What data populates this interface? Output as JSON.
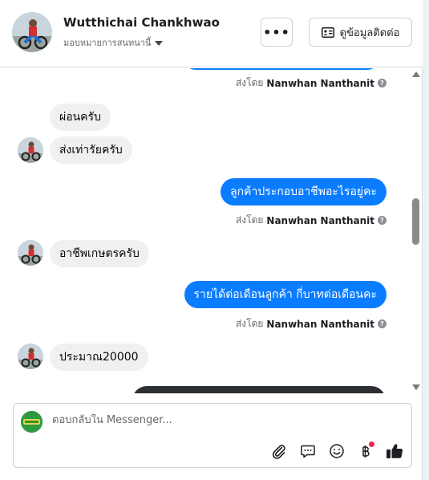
{
  "header": {
    "name": "Wutthichai Chankhwao",
    "assign_label": "มอบหมายการสนทนานี้",
    "contact_button": "ดูข้อมูลติดต่อ"
  },
  "messages": [
    {
      "dir": "in",
      "text": "ผ่อนครับ"
    },
    {
      "dir": "in",
      "text": "ส่งเท่ารัยครับ"
    },
    {
      "dir": "out",
      "text": "ลูกค้าประกอบอาชีพอะไรอยู่คะ"
    },
    {
      "dir": "in",
      "text": "อาชีพเกษตรครับ"
    },
    {
      "dir": "out",
      "text": "รายได้ต่อเดือนลูกค้า   กี่บาทต่อเดือนคะ"
    },
    {
      "dir": "in",
      "text": "ประมาณ20000"
    }
  ],
  "sent_by": {
    "prefix": "ส่งโดย",
    "agent": "Nanwhan Nanthanit"
  },
  "composer": {
    "placeholder": "ตอบกลับใน Messenger..."
  },
  "colors": {
    "outgoing_bubble": "#0a7cff",
    "incoming_bubble": "#f0f0f0",
    "badge": "#f02849"
  }
}
